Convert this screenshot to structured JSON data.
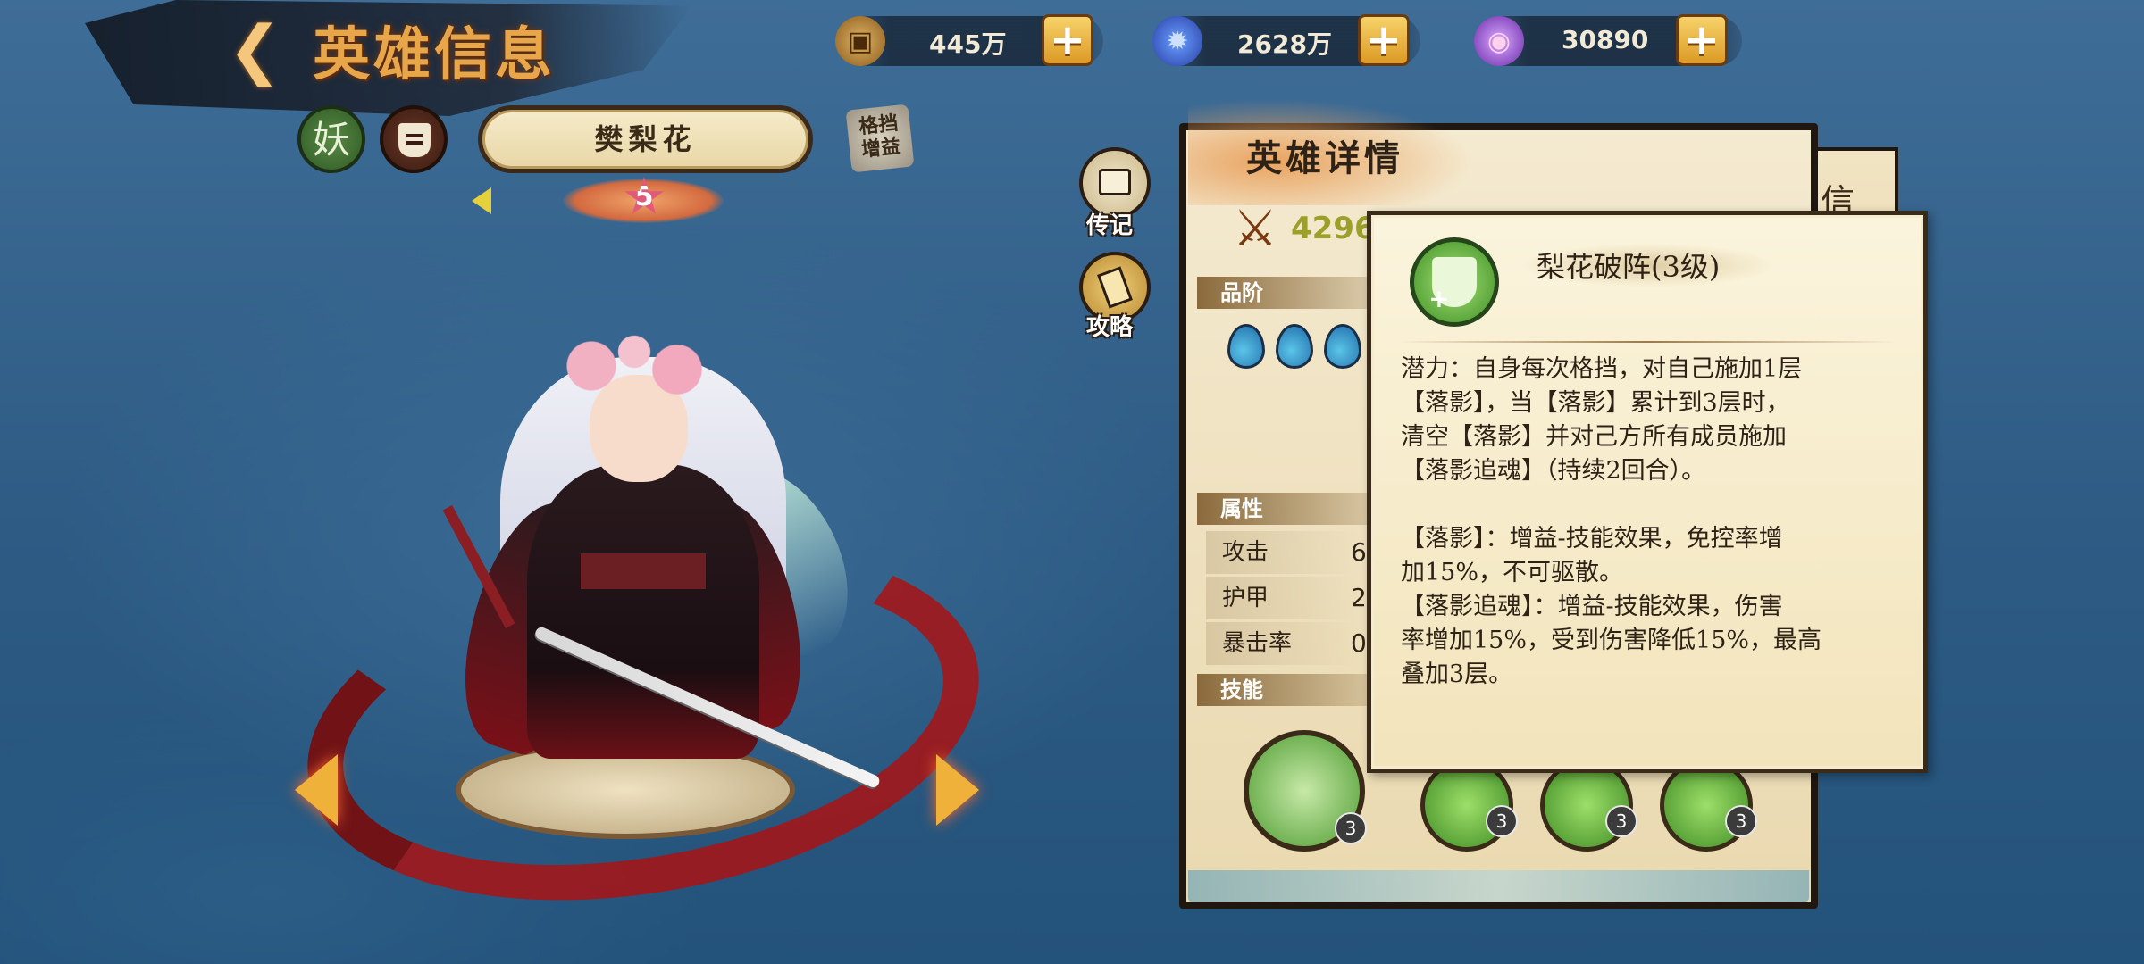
{
  "header": {
    "title": "英雄信息"
  },
  "resources": [
    {
      "icon": "coin-icon",
      "value": "445万"
    },
    {
      "icon": "soul-flame-icon",
      "value": "2628万"
    },
    {
      "icon": "purple-gem-icon",
      "value": "30890"
    }
  ],
  "hero": {
    "faction": "妖",
    "name": "樊梨花",
    "star": "5",
    "tag": "格挡\n增益"
  },
  "side_menu": [
    {
      "icon": "paw-scroll-icon",
      "label": "传记"
    },
    {
      "icon": "strategy-scroll-icon",
      "label": "攻略"
    }
  ],
  "panel": {
    "title": "英雄详情",
    "power": "4296",
    "back_tab_title": "信",
    "sections": {
      "rank": "品阶",
      "attributes": "属性",
      "skills": "技能"
    },
    "attributes": [
      {
        "label": "攻击",
        "value": "6"
      },
      {
        "label": "护甲",
        "value": "2"
      },
      {
        "label": "暴击率",
        "value": "0"
      }
    ],
    "skills": [
      {
        "icon": "spiral-leaf-icon",
        "level": "3"
      },
      {
        "icon": "green-beast-icon",
        "level": "3"
      },
      {
        "icon": "green-spirit-icon",
        "level": "3"
      },
      {
        "icon": "shield-plus-icon",
        "level": "3"
      }
    ]
  },
  "tooltip": {
    "title": "梨花破阵(3级)",
    "text": "潜力：自身每次格挡，对自己施加1层\n【落影】，当【落影】累计到3层时，\n清空【落影】并对己方所有成员施加\n【落影追魂】（持续2回合）。\n\n【落影】：增益-技能效果，免控率增\n加15%，不可驱散。\n【落影追魂】：增益-技能效果，伤害\n率增加15%，受到伤害降低15%，最高\n叠加3层。"
  },
  "colors": {
    "accent_gold": "#e8a64b",
    "plus_button": "#dc9a24",
    "skill_green": "#3f8c24"
  }
}
